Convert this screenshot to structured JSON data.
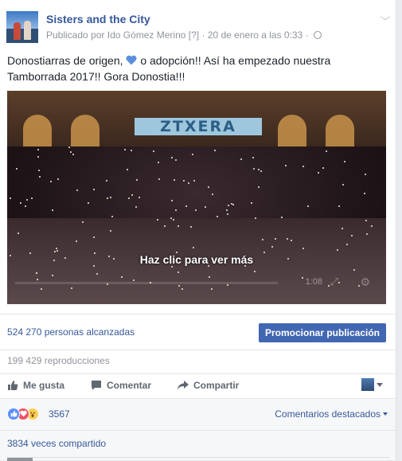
{
  "post": {
    "page_name": "Sisters and the City",
    "meta_prefix": "Publicado por",
    "author": "Ido Gómez Merino",
    "help_marker": "[?]",
    "date": "· 20 de enero a las 0:33 ·",
    "text": "Donostiarras de origen, 💙 o adopción!! Así ha empezado nuestra Tamborrada 2017!! Gora Donostia!!!",
    "text_before_heart": "Donostiarras de origen,",
    "text_after_heart": "o adopción!! Así ha empezado nuestra Tamborrada 2017!! Gora Donostia!!!",
    "heart_color": "#4a86e8"
  },
  "video": {
    "banner_text": "ZTXERA",
    "caption": "Haz clic para ver más",
    "time": "1:08"
  },
  "stats": {
    "reach": "524 270 personas alcanzadas",
    "promote_label": "Promocionar publicación",
    "plays": "199 429 reproducciones"
  },
  "actions": {
    "like": "Me gusta",
    "comment": "Comentar",
    "share": "Compartir"
  },
  "reactions": {
    "count": "3567",
    "top_comments": "Comentarios destacados",
    "shares": "3834 veces compartido"
  },
  "colors": {
    "link": "#365899",
    "button": "#4267b2",
    "muted": "#90949c"
  }
}
